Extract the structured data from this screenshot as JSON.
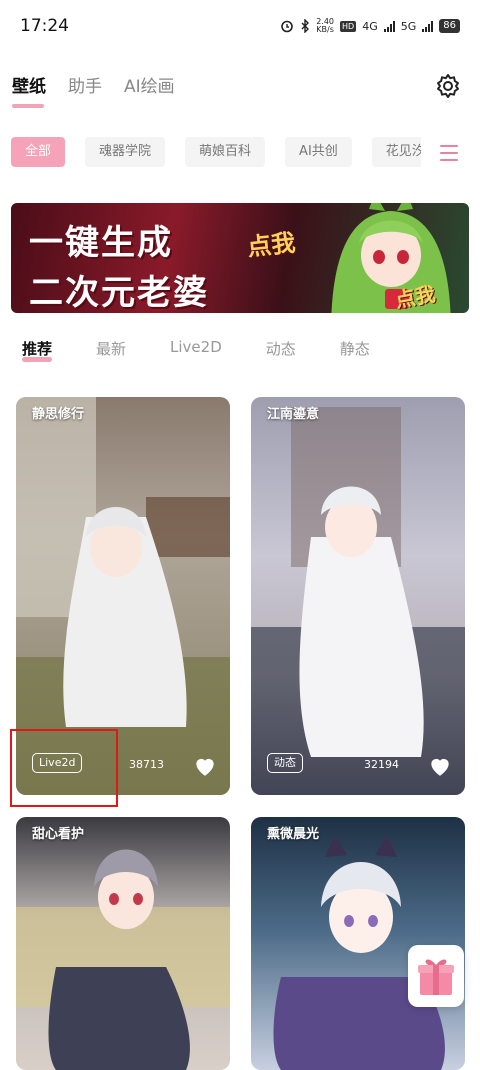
{
  "status_bar": {
    "time": "17:24",
    "net_speed_value": "2.40",
    "net_speed_unit": "KB/s",
    "hd_label": "HD",
    "sim1": "4G",
    "sim2": "5G",
    "battery": "86"
  },
  "top_tabs": [
    {
      "label": "壁纸",
      "active": true
    },
    {
      "label": "助手",
      "active": false
    },
    {
      "label": "AI绘画",
      "active": false
    }
  ],
  "categories": [
    {
      "label": "全部",
      "active": true
    },
    {
      "label": "魂器学院",
      "active": false
    },
    {
      "label": "萌娘百科",
      "active": false
    },
    {
      "label": "AI共创",
      "active": false
    },
    {
      "label": "花见汐梦",
      "active": false
    }
  ],
  "banner": {
    "line1": "一键生成",
    "line2": "二次元老婆",
    "cta": "点我"
  },
  "sub_tabs": [
    {
      "label": "推荐",
      "active": true
    },
    {
      "label": "最新",
      "active": false
    },
    {
      "label": "Live2D",
      "active": false
    },
    {
      "label": "动态",
      "active": false
    },
    {
      "label": "静态",
      "active": false
    }
  ],
  "cards": [
    {
      "title": "静思修行",
      "badge": "Live2d",
      "likes": "38713"
    },
    {
      "title": "江南鎏意",
      "badge": "动态",
      "likes": "32194"
    },
    {
      "title": "甜心看护"
    },
    {
      "title": "熏微晨光"
    }
  ],
  "colors": {
    "accent_pink": "#f3a3b6",
    "highlight_red": "#e01818"
  }
}
